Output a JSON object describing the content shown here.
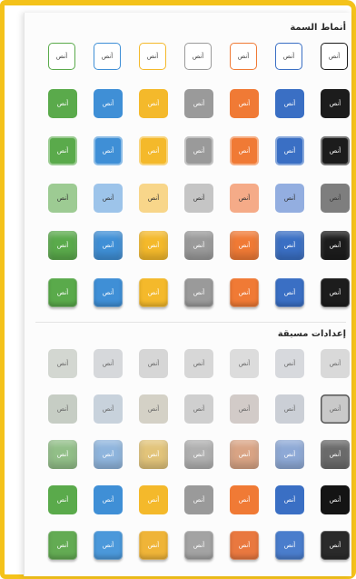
{
  "theme_styles": {
    "title": "أنماط السمة",
    "tile_label": "أنص",
    "palette": [
      "#1c1c1c",
      "#3a6fc4",
      "#f07a35",
      "#9a9a9a",
      "#f4b92b",
      "#3f8fd6",
      "#5aaa4b"
    ],
    "pale": [
      "#7e7e7e",
      "#93aee0",
      "#f5ab88",
      "#c5c5c5",
      "#f8d68a",
      "#9dc4ea",
      "#9dcb93"
    ]
  },
  "presets": {
    "title": "إعدادات مسبقة",
    "tile_label": "أنص",
    "row1": [
      "#d9d9d9",
      "#d7d9dd",
      "#dcdcdc",
      "#d7d7d7",
      "#d6d6d6",
      "#d6d8db",
      "#d3d7d1"
    ],
    "row2": [
      "#c9c9c9",
      "#cbcfd6",
      "#d2cbc8",
      "#cfcfcf",
      "#d4d1c6",
      "#c8d2dc",
      "#c6cdc4"
    ],
    "row3": [
      "#6b6b6b",
      "#8ea9d6",
      "#d9a485",
      "#b0b0b0",
      "#e2c47a",
      "#8fb5dd",
      "#92bf88"
    ],
    "row4": [
      "#141414",
      "#3a6fc4",
      "#f07a35",
      "#9a9a9a",
      "#f4b92b",
      "#3f8fd6",
      "#5aaa4b"
    ],
    "row5": [
      "#2a2a2a",
      "#4a7dcc",
      "#e9783f",
      "#a3a3a3",
      "#efb438",
      "#4b98da",
      "#63ab53"
    ]
  }
}
